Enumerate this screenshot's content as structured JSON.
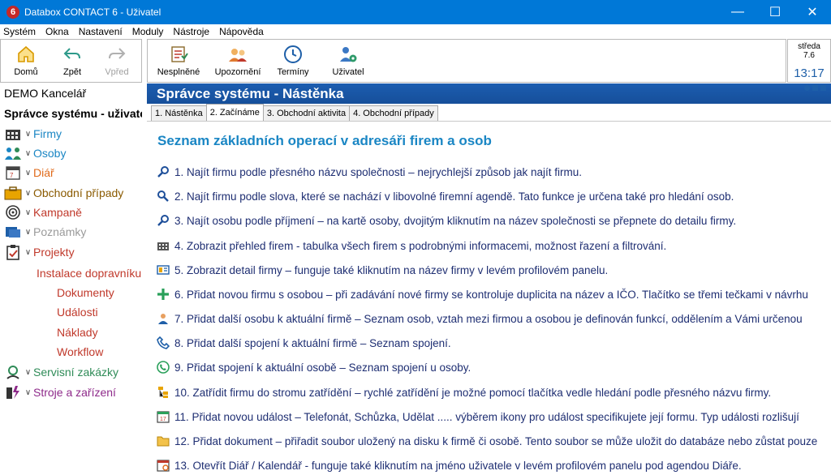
{
  "window": {
    "title": "Databox CONTACT 6 - Uživatel",
    "app_icon": "6",
    "controls": {
      "minimize": "—",
      "maximize": "☐",
      "close": "✕"
    }
  },
  "menu": [
    "Systém",
    "Okna",
    "Nastavení",
    "Moduly",
    "Nástroje",
    "Nápověda"
  ],
  "nav_toolbar": [
    {
      "label": "Domů",
      "icon": "home-icon",
      "enabled": true
    },
    {
      "label": "Zpět",
      "icon": "back-arrow-icon",
      "enabled": true
    },
    {
      "label": "Vpřed",
      "icon": "forward-arrow-icon",
      "enabled": false
    }
  ],
  "main_toolbar": [
    {
      "label": "Nesplněné",
      "icon": "checklist-icon"
    },
    {
      "label": "Upozornění",
      "icon": "warning-people-icon"
    },
    {
      "label": "Termíny",
      "icon": "clock-icon"
    },
    {
      "label": "Uživatel",
      "icon": "user-gear-icon"
    }
  ],
  "clock": {
    "day": "středa",
    "version": "7.6",
    "time": "13:17"
  },
  "sidebar": {
    "org": "DEMO Kancelář",
    "user": "Správce systému - uživatel",
    "items": [
      {
        "label": "Firmy",
        "icon": "building-icon",
        "color": "#1a86c4",
        "expanded": false
      },
      {
        "label": "Osoby",
        "icon": "people-icon",
        "color": "#1a86c4",
        "expanded": false
      },
      {
        "label": "Diář",
        "icon": "calendar-icon",
        "color": "#e06a1a",
        "expanded": false
      },
      {
        "label": "Obchodní případy",
        "icon": "briefcase-icon",
        "color": "#8a5a00",
        "expanded": false
      },
      {
        "label": "Kampaně",
        "icon": "target-icon",
        "color": "#c0392b",
        "expanded": false
      },
      {
        "label": "Poznámky",
        "icon": "notes-icon",
        "color": "#9a9a9a",
        "expanded": false
      },
      {
        "label": "Projekty",
        "icon": "clipboard-icon",
        "color": "#c0392b",
        "expanded": true
      },
      {
        "label": "Servisní zakázky",
        "icon": "service-icon",
        "color": "#2e8b57",
        "expanded": false
      },
      {
        "label": "Stroje a zařízení",
        "icon": "machine-icon",
        "color": "#8e2a8a",
        "expanded": false
      }
    ],
    "project_name": "Instalace dopravníku",
    "project_children": [
      "Dokumenty",
      "Události",
      "Náklady",
      "Workflow"
    ]
  },
  "content": {
    "header": "Správce systému - Nástěnka",
    "tabs": [
      "1. Nástěnka",
      "2. Začínáme",
      "3. Obchodní aktivita",
      "4. Obchodní případy"
    ],
    "active_tab": 1,
    "section_title": "Seznam základních operací v adresáři firem a osob",
    "operations": [
      {
        "text": "1. Najít firmu podle přesného názvu společnosti – nejrychlejší způsob jak najít firmu.",
        "icon": "search-icon"
      },
      {
        "text": "2. Najít firmu podle slova, které se nachází v libovolné firemní agendě. Tato funkce je určena také pro hledání osob.",
        "icon": "search-zoom-icon"
      },
      {
        "text": "3. Najít osobu podle příjmení – na kartě osoby, dvojitým kliknutím na název společnosti se přepnete do detailu firmy.",
        "icon": "search-icon"
      },
      {
        "text": "4. Zobrazit přehled firem - tabulka všech firem s podrobnými informacemi, možnost řazení a filtrování.",
        "icon": "building-table-icon"
      },
      {
        "text": "5. Zobrazit detail firmy – funguje také kliknutím na název firmy v levém profilovém panelu.",
        "icon": "detail-card-icon"
      },
      {
        "text": "6. Přidat novou firmu s osobou – při zadávání nové firmy se kontroluje duplicita na název a IČO. Tlačítko se třemi tečkami v návrhu",
        "icon": "plus-icon"
      },
      {
        "text": "7. Přidat další osobu k aktuální firmě – Seznam osob, vztah mezi firmou a osobou je definován funkcí, oddělením a Vámi určenou",
        "icon": "add-person-icon"
      },
      {
        "text": "8. Přidat další spojení k aktuální firmě – Seznam spojení.",
        "icon": "phone-icon"
      },
      {
        "text": "9. Přidat spojení k aktuální osobě – Seznam spojení u osoby.",
        "icon": "phone-circle-icon"
      },
      {
        "text": "10. Zatřídit firmu do stromu zatřídění – rychlé zatřídění je možné pomocí tlačítka vedle hledání podle přesného názvu firmy.",
        "icon": "tree-icon"
      },
      {
        "text": "11. Přidat novou událost – Telefonát, Schůzka, Udělat ..... výběrem ikony pro událost specifikujete její formu. Typ události rozlišují",
        "icon": "calendar-event-icon"
      },
      {
        "text": "12. Přidat dokument – přiřadit soubor uložený na disku k firmě či osobě. Tento soubor se může uložit do databáze nebo zůstat pouze",
        "icon": "folder-icon"
      },
      {
        "text": "13. Otevřít Diář / Kalendář - funguje také kliknutím na jméno uživatele v levém profilovém panelu pod agendou Diáře.",
        "icon": "diary-icon"
      }
    ]
  }
}
